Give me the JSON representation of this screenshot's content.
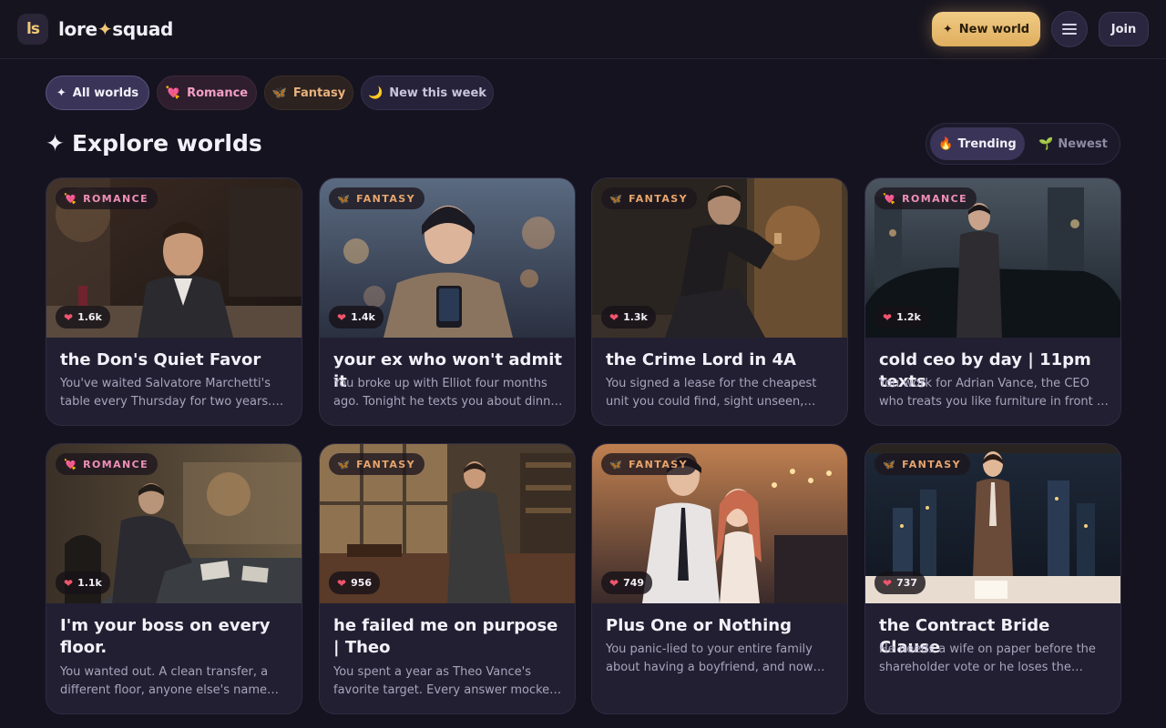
{
  "header": {
    "logo_mark": "ls",
    "brand_left": "lore",
    "brand_star": "✦",
    "brand_right": "squad",
    "new_world_icon": "✦",
    "new_world_label": "New world",
    "join_label": "Join"
  },
  "filters": [
    {
      "icon": "✦",
      "label": "All worlds",
      "active": true
    },
    {
      "icon": "💘",
      "label": "Romance"
    },
    {
      "icon": "🦋",
      "label": "Fantasy"
    },
    {
      "icon": "🌙",
      "label": "New this week"
    }
  ],
  "section": {
    "icon": "✦",
    "title": "Explore worlds",
    "sort": [
      {
        "icon": "🔥",
        "label": "Trending",
        "active": true
      },
      {
        "icon": "🌱",
        "label": "Newest"
      }
    ]
  },
  "cards": [
    {
      "tag": "ROMANCE",
      "tag_icon": "💘",
      "likes": "1.6k",
      "title": "the Don's Quiet Favor",
      "desc": "You've waited Salvatore Marchetti's table every Thursday for two years. You know..."
    },
    {
      "tag": "FANTASY",
      "tag_icon": "🦋",
      "likes": "1.4k",
      "title": "your ex who won't admit it",
      "desc": "You broke up with Elliot four months ago. Tonight he texts you about dinner plans..."
    },
    {
      "tag": "FANTASY",
      "tag_icon": "🦋",
      "likes": "1.3k",
      "title": "the Crime Lord in 4A",
      "desc": "You signed a lease for the cheapest unit you could find, sight unseen, running fro..."
    },
    {
      "tag": "ROMANCE",
      "tag_icon": "💘",
      "likes": "1.2k",
      "title": "cold ceo by day | 11pm texts",
      "desc": "You work for Adrian Vance, the CEO who treats you like furniture in front of the..."
    },
    {
      "tag": "ROMANCE",
      "tag_icon": "💘",
      "likes": "1.1k",
      "title": "I'm your boss on every floor.",
      "desc": "You wanted out. A clean transfer, a different floor, anyone else's name on..."
    },
    {
      "tag": "FANTASY",
      "tag_icon": "🦋",
      "likes": "956",
      "title": "he failed me on purpose | Theo",
      "desc": "You spent a year as Theo Vance's favorite target. Every answer mocked, every..."
    },
    {
      "tag": "FANTASY",
      "tag_icon": "🦋",
      "likes": "749",
      "title": "Plus One or Nothing",
      "desc": "You panic-lied to your entire family about having a boyfriend, and now your cousin'..."
    },
    {
      "tag": "FANTASY",
      "tag_icon": "🦋",
      "likes": "737",
      "title": "the Contract Bride Clause",
      "desc": "He needs a wife on paper before the shareholder vote or he loses the compa..."
    }
  ],
  "colors": {
    "background": "#15131f",
    "accent_gold": "#f0c777",
    "romance": "#f08fb8",
    "fantasy": "#e8a56e",
    "heart": "#f0546d"
  }
}
